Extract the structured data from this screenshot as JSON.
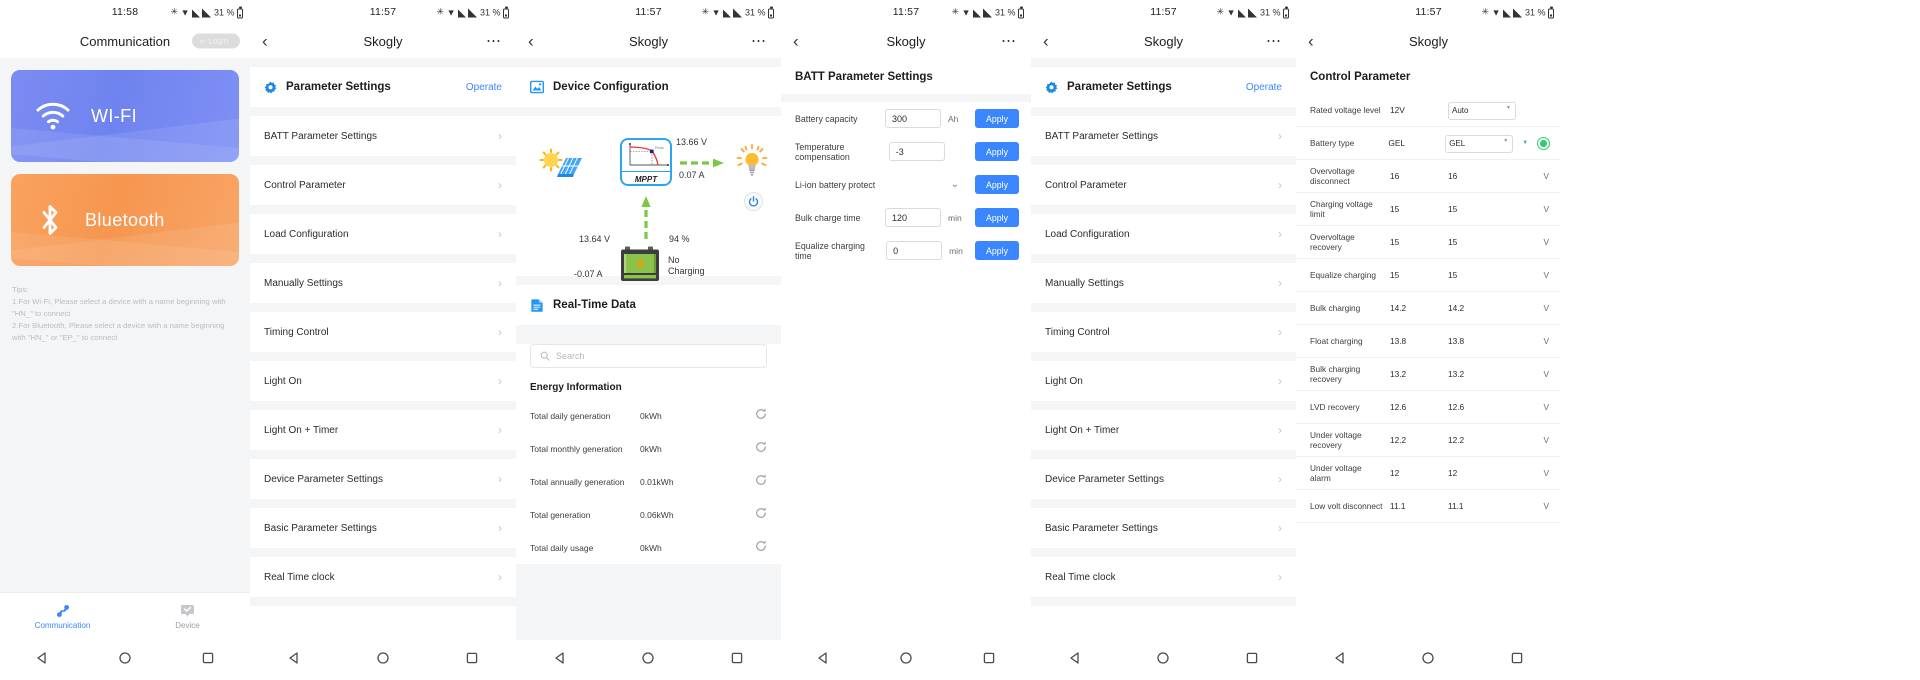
{
  "panels": {
    "communication": {
      "status": {
        "clock": "11:58",
        "battery_pct": "31 %"
      },
      "header": {
        "title": "Communication",
        "login_label": "Login"
      },
      "cards": [
        {
          "label": "WI-FI",
          "icon": "wifi-icon",
          "color": "#7182f1"
        },
        {
          "label": "Bluetooth",
          "icon": "bluetooth-icon",
          "color": "#f79a55"
        }
      ],
      "tips": "Tips:\n1.For Wi-Fi, Please select a device with a name beginning with \"HN_\" to connect\n2.For Bluetooth, Please select a device with a name beginning with \"HN_\" or \"EP_\" to connect",
      "tabs": [
        {
          "label": "Communication",
          "icon": "plug-connect-icon",
          "active": true
        },
        {
          "label": "Device",
          "icon": "device-check-icon",
          "active": false
        }
      ]
    },
    "param_list": {
      "status": {
        "clock": "11:57",
        "battery_pct": "31 %"
      },
      "header": {
        "title": "Skogly"
      },
      "section": {
        "title": "Parameter Settings",
        "action": "Operate",
        "icon": "gear-icon"
      },
      "items": [
        "BATT Parameter Settings",
        "Control Parameter",
        "Load Configuration",
        "Manually Settings",
        "Timing Control",
        "Light On",
        "Light On + Timer",
        "Device Parameter Settings",
        "Basic Parameter Settings",
        "Real Time clock"
      ]
    },
    "device_config": {
      "status": {
        "clock": "11:57",
        "battery_pct": "31 %"
      },
      "header": {
        "title": "Skogly"
      },
      "section": {
        "title": "Device Configuration",
        "icon": "image-icon"
      },
      "diagram": {
        "controller_label": "MPPT",
        "pv_to_mppt_icon": "solar-panel-icon",
        "load_icon": "lightbulb-icon",
        "power_icon": "power-button-icon",
        "load_voltage": "13.66 V",
        "load_current": "0.07 A",
        "battery_voltage": "13.64 V",
        "battery_current": "-0.07 A",
        "battery_soc": "94 %",
        "battery_status": "No\nCharging"
      },
      "realtime": {
        "title": "Real-Time Data",
        "icon": "document-icon",
        "search_placeholder": "Search",
        "group_title": "Energy Information",
        "rows": [
          {
            "key": "Total daily generation",
            "value": "0kWh"
          },
          {
            "key": "Total monthly generation",
            "value": "0kWh"
          },
          {
            "key": "Total annually generation",
            "value": "0.01kWh"
          },
          {
            "key": "Total generation",
            "value": "0.06kWh"
          },
          {
            "key": "Total daily usage",
            "value": "0kWh"
          }
        ]
      }
    },
    "batt_params": {
      "status": {
        "clock": "11:57",
        "battery_pct": "31 %"
      },
      "header": {
        "title": "Skogly"
      },
      "title": "BATT Parameter Settings",
      "apply_label": "Apply",
      "fields": [
        {
          "label": "Battery capacity",
          "value": "300",
          "unit": "Ah",
          "type": "input"
        },
        {
          "label": "Temperature compensation",
          "value": "-3",
          "unit": "",
          "type": "input"
        },
        {
          "label": "Li-ion battery protect",
          "value": "",
          "unit": "",
          "type": "dropdown"
        },
        {
          "label": "Bulk charge time",
          "value": "120",
          "unit": "min",
          "type": "input"
        },
        {
          "label": "Equalize charging time",
          "value": "0",
          "unit": "min",
          "type": "input"
        }
      ]
    },
    "param_list2": {
      "status": {
        "clock": "11:57",
        "battery_pct": "31 %"
      },
      "header": {
        "title": "Skogly"
      },
      "section": {
        "title": "Parameter Settings",
        "action": "Operate",
        "icon": "gear-icon"
      },
      "items": [
        "BATT Parameter Settings",
        "Control Parameter",
        "Load Configuration",
        "Manually Settings",
        "Timing Control",
        "Light On",
        "Light On + Timer",
        "Device Parameter Settings",
        "Basic Parameter Settings",
        "Real Time clock"
      ]
    },
    "control_param": {
      "status": {
        "clock": "11:57",
        "battery_pct": "31 %"
      },
      "header": {
        "title": "Skogly"
      },
      "title": "Control Parameter",
      "rows": [
        {
          "key": "Rated voltage level",
          "c2": "12V",
          "c3": "Auto",
          "c4": "",
          "kind": "select"
        },
        {
          "key": "Battery type",
          "c2": "GEL",
          "c3": "GEL",
          "c4": "",
          "kind": "select-dot"
        },
        {
          "key": "Overvoltage disconnect",
          "c2": "16",
          "c3": "16",
          "c4": "V",
          "kind": "text"
        },
        {
          "key": "Charging voltage limit",
          "c2": "15",
          "c3": "15",
          "c4": "V",
          "kind": "text"
        },
        {
          "key": "Overvoltage recovery",
          "c2": "15",
          "c3": "15",
          "c4": "V",
          "kind": "text"
        },
        {
          "key": "Equalize charging",
          "c2": "15",
          "c3": "15",
          "c4": "V",
          "kind": "text"
        },
        {
          "key": "Bulk charging",
          "c2": "14.2",
          "c3": "14.2",
          "c4": "V",
          "kind": "text"
        },
        {
          "key": "Float charging",
          "c2": "13.8",
          "c3": "13.8",
          "c4": "V",
          "kind": "text"
        },
        {
          "key": "Bulk charging recovery",
          "c2": "13.2",
          "c3": "13.2",
          "c4": "V",
          "kind": "text"
        },
        {
          "key": "LVD recovery",
          "c2": "12.6",
          "c3": "12.6",
          "c4": "V",
          "kind": "text"
        },
        {
          "key": "Under voltage recovery",
          "c2": "12.2",
          "c3": "12.2",
          "c4": "V",
          "kind": "text"
        },
        {
          "key": "Under voltage alarm",
          "c2": "12",
          "c3": "12",
          "c4": "V",
          "kind": "text"
        },
        {
          "key": "Low volt disconnect",
          "c2": "11.1",
          "c3": "11.1",
          "c4": "V",
          "kind": "text"
        }
      ]
    }
  },
  "nav": {
    "back": "back-triangle",
    "home": "home-circle",
    "recents": "recents-square"
  },
  "colors": {
    "accent": "#3a86ff",
    "wifi": "#7182f1",
    "bluetooth": "#f79a55",
    "flow": "#7ac943",
    "mppt_border": "#2aa7f0"
  }
}
